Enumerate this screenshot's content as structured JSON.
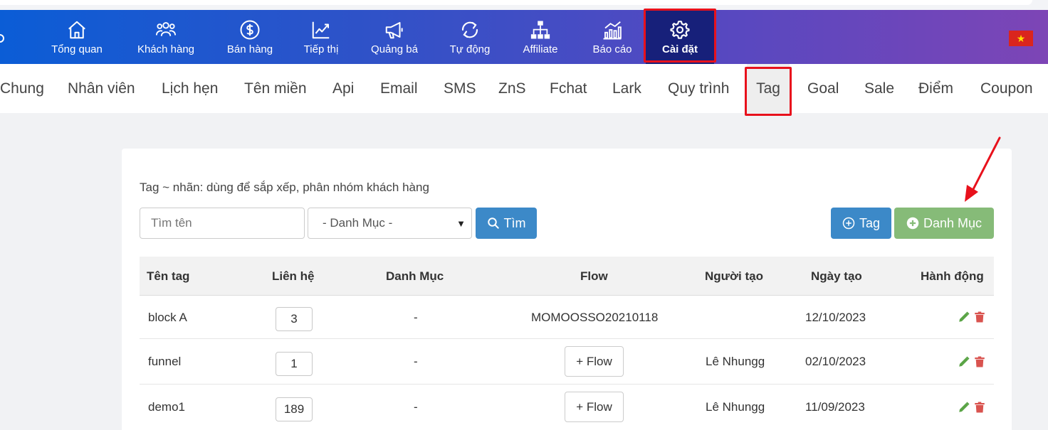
{
  "nav": {
    "items": [
      {
        "label": "Tổng quan",
        "icon": "home-icon"
      },
      {
        "label": "Khách hàng",
        "icon": "users-icon"
      },
      {
        "label": "Bán hàng",
        "icon": "dollar-icon"
      },
      {
        "label": "Tiếp thị",
        "icon": "chart-line-icon"
      },
      {
        "label": "Quảng bá",
        "icon": "megaphone-icon"
      },
      {
        "label": "Tự động",
        "icon": "refresh-icon"
      },
      {
        "label": "Affiliate",
        "icon": "sitemap-icon"
      },
      {
        "label": "Báo cáo",
        "icon": "report-chart-icon"
      },
      {
        "label": "Cài đặt",
        "icon": "gear-icon"
      }
    ],
    "active": "Cài đặt",
    "flag": "vietnam-flag"
  },
  "tabs": {
    "items": [
      "Chung",
      "Nhân viên",
      "Lịch hẹn",
      "Tên miền",
      "Api",
      "Email",
      "SMS",
      "ZnS",
      "Fchat",
      "Lark",
      "Quy trình",
      "Tag",
      "Goal",
      "Sale",
      "Điểm",
      "Coupon"
    ],
    "active": "Tag"
  },
  "page": {
    "description": "Tag ~ nhãn: dùng để sắp xếp, phân nhóm khách hàng",
    "search_placeholder": "Tìm tên",
    "category_select": "- Danh Mục -",
    "search_button": "Tìm",
    "add_tag_button": "Tag",
    "add_category_button": "Danh Mục"
  },
  "table": {
    "headers": [
      "Tên tag",
      "Liên hệ",
      "Danh Mục",
      "Flow",
      "Người tạo",
      "Ngày tạo",
      "Hành động"
    ],
    "rows": [
      {
        "name": "block A",
        "contacts": "3",
        "category": "-",
        "flow": "MOMOOSSO20210118",
        "creator": "",
        "date": "12/10/2023"
      },
      {
        "name": "funnel",
        "contacts": "1",
        "category": "-",
        "flow_button": "+ Flow",
        "creator": "Lê Nhungg",
        "date": "02/10/2023"
      },
      {
        "name": "demo1",
        "contacts": "189",
        "category": "-",
        "flow_button": "+ Flow",
        "creator": "Lê Nhungg",
        "date": "11/09/2023"
      }
    ]
  },
  "colors": {
    "nav_active": "#17207a",
    "highlight_box": "#e8111c",
    "primary_button": "#3c89c8",
    "success_button": "#86bb78",
    "edit_icon": "#5aa446",
    "delete_icon": "#d9534f"
  }
}
